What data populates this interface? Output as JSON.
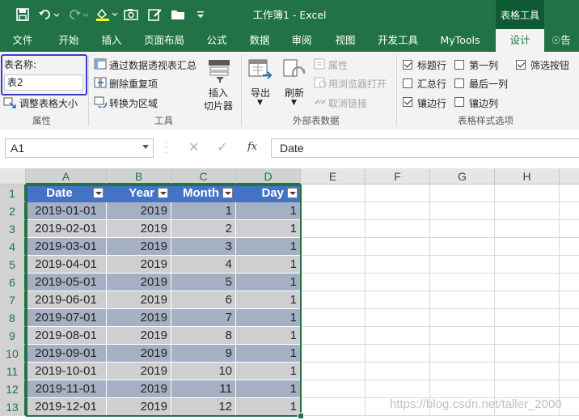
{
  "window": {
    "title": "工作簿1  -  Excel",
    "context_tab": "表格工具"
  },
  "tabs": [
    {
      "label": "文件"
    },
    {
      "label": "开始"
    },
    {
      "label": "插入"
    },
    {
      "label": "页面布局"
    },
    {
      "label": "公式"
    },
    {
      "label": "数据"
    },
    {
      "label": "审阅"
    },
    {
      "label": "视图"
    },
    {
      "label": "开发工具"
    },
    {
      "label": "MyTools"
    },
    {
      "label": "设计",
      "active": true
    },
    {
      "label": "告"
    }
  ],
  "ribbon": {
    "properties": {
      "name_label": "表名称:",
      "name_value": "表2",
      "resize_label": "调整表格大小",
      "group": "属性"
    },
    "tools": {
      "pivot": "通过数据透视表汇总",
      "dedupe": "删除重复项",
      "convert": "转换为区域",
      "slicer_1": "插入",
      "slicer_2": "切片器",
      "group": "工具"
    },
    "external": {
      "export": "导出",
      "refresh": "刷新",
      "props": "属性",
      "open_browser": "用浏览器打开",
      "unlink": "取消链接",
      "group": "外部表数据"
    },
    "style_options": {
      "header_row": "标题行",
      "total_row": "汇总行",
      "banded_rows": "镶边行",
      "first_column": "第一列",
      "last_column": "最后一列",
      "banded_columns": "镶边列",
      "filter_button": "筛选按钮",
      "group": "表格样式选项",
      "checked": {
        "header_row": true,
        "total_row": false,
        "banded_rows": true,
        "first_column": false,
        "last_column": false,
        "banded_columns": false,
        "filter_button": true
      }
    }
  },
  "formula_bar": {
    "name_box": "A1",
    "fx": "fx",
    "content": "Date"
  },
  "columns": [
    "A",
    "B",
    "C",
    "D",
    "E",
    "F",
    "G",
    "H"
  ],
  "rows": [
    "1",
    "2",
    "3",
    "4",
    "5",
    "6",
    "7",
    "8",
    "9",
    "10",
    "11",
    "12",
    "13"
  ],
  "table": {
    "headers": [
      "Date",
      "Year",
      "Month",
      "Day"
    ],
    "data": [
      [
        "2019-01-01",
        "2019",
        "1",
        "1"
      ],
      [
        "2019-02-01",
        "2019",
        "2",
        "1"
      ],
      [
        "2019-03-01",
        "2019",
        "3",
        "1"
      ],
      [
        "2019-04-01",
        "2019",
        "4",
        "1"
      ],
      [
        "2019-05-01",
        "2019",
        "5",
        "1"
      ],
      [
        "2019-06-01",
        "2019",
        "6",
        "1"
      ],
      [
        "2019-07-01",
        "2019",
        "7",
        "1"
      ],
      [
        "2019-08-01",
        "2019",
        "8",
        "1"
      ],
      [
        "2019-09-01",
        "2019",
        "9",
        "1"
      ],
      [
        "2019-10-01",
        "2019",
        "10",
        "1"
      ],
      [
        "2019-11-01",
        "2019",
        "11",
        "1"
      ],
      [
        "2019-12-01",
        "2019",
        "12",
        "1"
      ]
    ]
  },
  "watermark": "https://blog.csdn.net/taller_2000",
  "colors": {
    "excel_green": "#217346",
    "table_header": "#4472c4",
    "band_dark": "#a6b0c3",
    "band_light": "#cfcfd1",
    "highlight_box": "#3b3bd4"
  }
}
